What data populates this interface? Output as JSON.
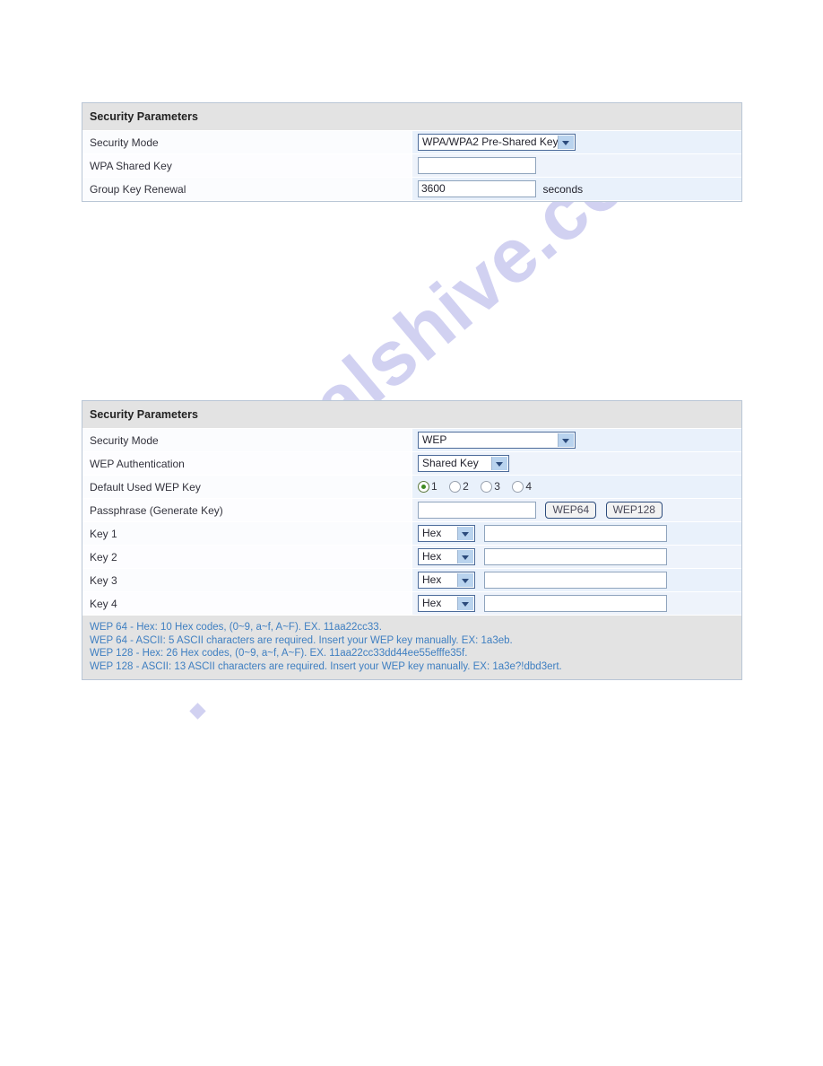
{
  "watermark": {
    "text": "manualshive.com"
  },
  "wpa_panel": {
    "title": "Security Parameters",
    "rows": [
      {
        "label": "Security Mode",
        "value": "WPA/WPA2 Pre-Shared Key",
        "control": "select"
      },
      {
        "label": "WPA Shared Key",
        "value": "",
        "control": "input"
      },
      {
        "label": "Group Key Renewal",
        "value": "3600",
        "control": "input",
        "unit": "seconds"
      }
    ]
  },
  "wep_panel": {
    "title": "Security Parameters",
    "security_mode": {
      "label": "Security Mode",
      "value": "WEP"
    },
    "wep_authentication": {
      "label": "WEP Authentication",
      "value": "Shared Key"
    },
    "default_used_wep_key": {
      "label": "Default Used WEP Key",
      "options": [
        "1",
        "2",
        "3",
        "4"
      ],
      "selected": "1"
    },
    "passphrase": {
      "label": "Passphrase (Generate Key)",
      "value": "",
      "buttons": [
        "WEP64",
        "WEP128"
      ]
    },
    "keys": [
      {
        "label": "Key 1",
        "type": "Hex",
        "value": ""
      },
      {
        "label": "Key 2",
        "type": "Hex",
        "value": ""
      },
      {
        "label": "Key 3",
        "type": "Hex",
        "value": ""
      },
      {
        "label": "Key 4",
        "type": "Hex",
        "value": ""
      }
    ],
    "notes": [
      "WEP 64 - Hex: 10 Hex codes, (0~9, a~f, A~F). EX. 11aa22cc33.",
      "WEP 64 - ASCII: 5 ASCII characters are required. Insert your WEP key manually. EX: 1a3eb.",
      "WEP 128 - Hex: 26 Hex codes, (0~9, a~f, A~F). EX. 11aa22cc33dd44ee55efffe35f.",
      "WEP 128 - ASCII: 13 ASCII characters are required. Insert your WEP key manually. EX: 1a3e?!dbd3ert."
    ]
  },
  "colors": {
    "panel_border": "#b9c6d6",
    "header_bg": "#e3e3e3",
    "row_bg": "#e9f1fb",
    "note_text": "#3f7fc1",
    "radio_selected": "#3f8b20",
    "select_border": "#4c6b9a",
    "watermark": "#c9c9ef"
  }
}
